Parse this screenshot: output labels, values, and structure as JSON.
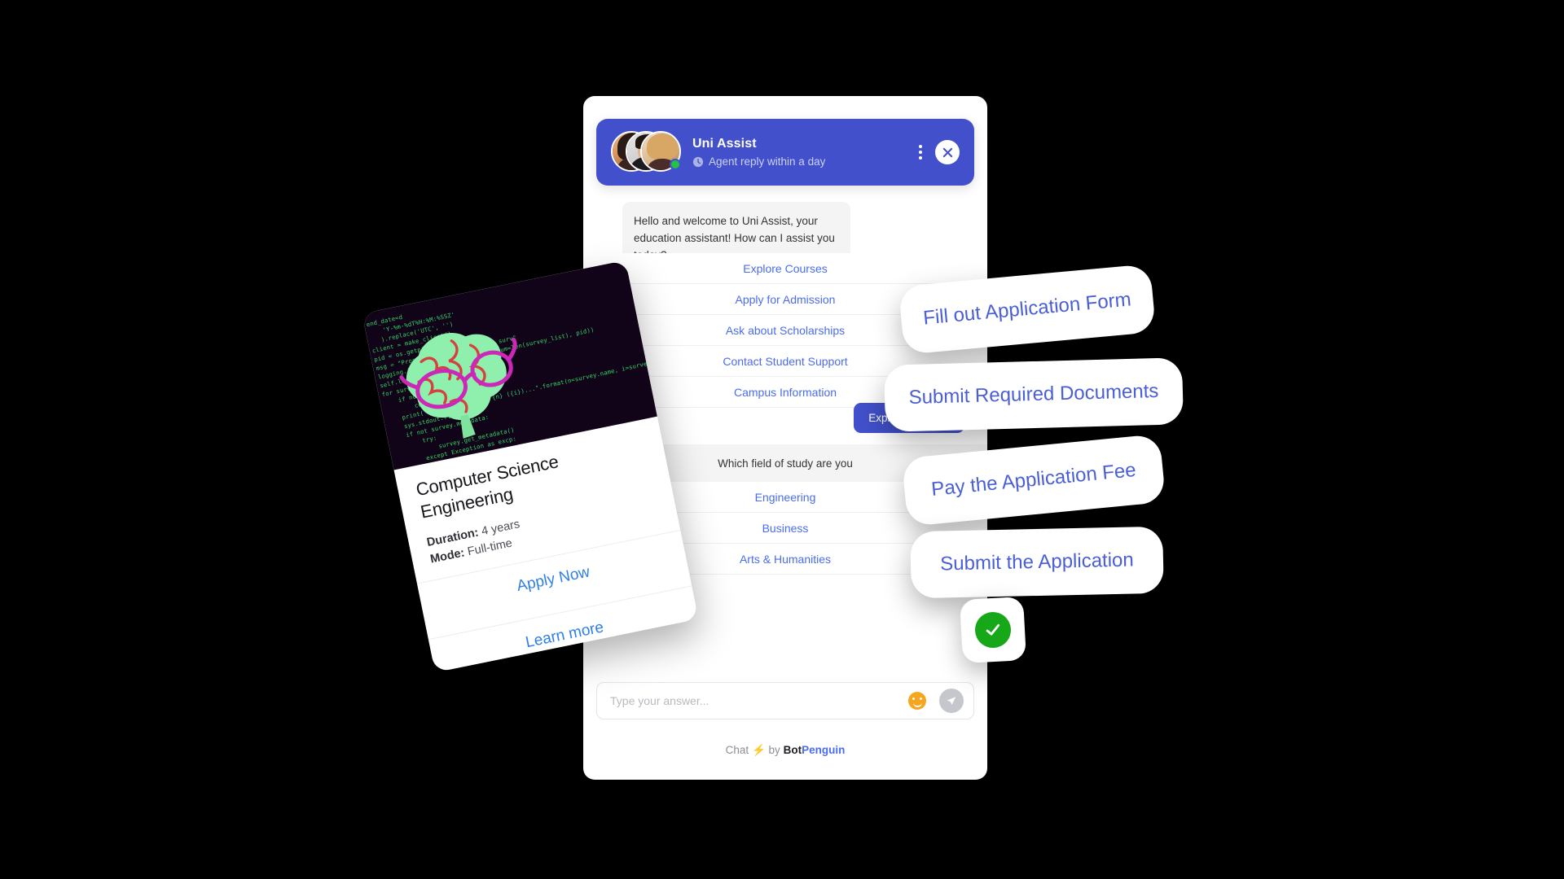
{
  "widget": {
    "header": {
      "title": "Uni Assist",
      "status": "Agent reply within a day",
      "status_icon": "clock-icon",
      "menu_icon": "kebab-menu-icon",
      "close_icon": "close-icon",
      "online_indicator": "online-status-dot",
      "bg_color": "#4250cb"
    },
    "messages": [
      {
        "from": "bot",
        "text": "Hello and welcome to Uni Assist, your education assistant! How can I assist you today?"
      }
    ],
    "quick_replies": [
      "Explore Courses",
      "Apply for Admission",
      "Ask about Scholarships",
      "Contact Student Support",
      "Campus Information"
    ],
    "user_reply": "Explore Courses",
    "followup_question": "Which field of study are you",
    "followup_options": [
      "Engineering",
      "Business",
      "Arts & Humanities"
    ],
    "composer": {
      "placeholder": "Type your answer...",
      "value": "",
      "emoji_icon": "emoji-smiley-icon",
      "send_icon": "send-paper-plane-icon"
    },
    "footer": {
      "chat": "Chat",
      "bolt": "⚡",
      "by": "by",
      "brand_first": "Bot",
      "brand_second": "Penguin",
      "brand_color": "#4a6cf0"
    }
  },
  "course_card": {
    "image_alt": "green-brain-with-glasses-on-code-background",
    "title": "Computer Science Engineering",
    "duration_label": "Duration:",
    "duration_value": "4 years",
    "mode_label": "Mode:",
    "mode_value": "Full-time",
    "primary_action": "Apply Now",
    "secondary_action": "Learn more",
    "code_snippet": "end_date=d\n    'Y-%m-%dT%H:%M:%SSZ'\n   ).replace('UTC', '')\nclient = make_client()\npid = os.getpid()\nmsg = \"Process ID {pid} got {num} surv\"\nlogging.info(msg.format(pid=pid, num=len(survey_list), pid))\nself.log_info(survey_list, pid)\nfor survey in survey_list:\n    if not survey:\n        continue\n    print(\"Processing survey {n} ({i})...\".format(n=survey.name, i=survey.survey_id))\n    sys.stdout.flush()\n    if not survey.metadata:\n        try:\n            survey.get_metadata()\n        except Exception as excp:\n            print(excp)"
  },
  "flow_pills": [
    "Fill out Application Form",
    "Submit Required Documents",
    "Pay the Application Fee",
    "Submit the Application"
  ],
  "success_badge": {
    "icon": "green-check-icon",
    "color": "#17a81a"
  },
  "background_color": "#000000"
}
